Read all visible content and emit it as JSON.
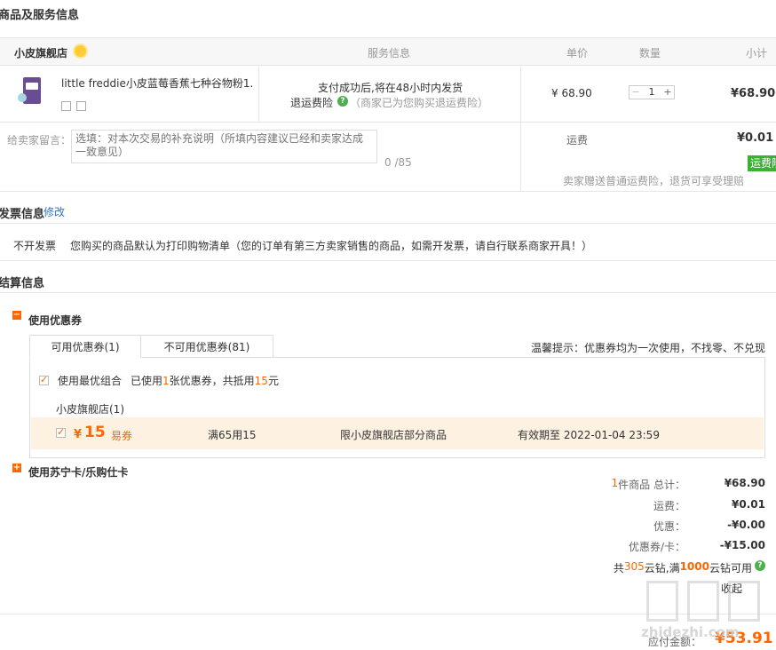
{
  "goods_section": {
    "title": "商品及服务信息"
  },
  "table_header": {
    "shop": "小皮旗舰店",
    "service": "服务信息",
    "unit_price": "单价",
    "quantity": "数量",
    "subtotal": "小计"
  },
  "item": {
    "name": "little freddie小皮蓝莓香蕉七种谷物粉1...",
    "service_line1": "支付成功后,将在48小时内发货",
    "service_line2_label": "退运费险",
    "service_line2_note": "（商家已为您购买退运费险）",
    "unit_price": "¥ 68.90",
    "qty_minus": "−",
    "qty_value": "1",
    "qty_plus": "+",
    "subtotal": "¥68.90"
  },
  "message": {
    "label": "给卖家留言：",
    "placeholder": "选填：对本次交易的补充说明（所填内容建议已经和卖家达成一致意见）",
    "counter": "0 /85",
    "shipping_label": "运费",
    "shipping_value": "¥0.01",
    "shipping_badge": "运费险",
    "shipping_note": "卖家赠送普通运费险，退货可享受理赔"
  },
  "invoice": {
    "title": "发票信息",
    "edit": "修改",
    "type": "不开发票",
    "desc": "您购买的商品默认为打印购物清单（您的订单有第三方卖家销售的商品，如需开发票，请自行联系商家开具！）"
  },
  "settle": {
    "title": "结算信息"
  },
  "coupon": {
    "title": "使用优惠券",
    "tab_available": "可用优惠券(1)",
    "tab_unavailable": "不可用优惠券(81)",
    "tip": "温馨提示：优惠券均为一次使用，不找零、不兑现",
    "best_combo": "使用最优组合",
    "used_prefix": "已使用",
    "used_count": "1",
    "used_mid": "张优惠券，共抵用",
    "used_amount": "15",
    "used_suffix": "元",
    "shop": "小皮旗舰店(1)",
    "currency": "¥",
    "amount": "15",
    "kind": "易券",
    "condition": "满65用15",
    "scope": "限小皮旗舰店部分商品",
    "expiry": "有效期至 2022-01-04 23:59"
  },
  "card": {
    "title": "使用苏宁卡/乐购仕卡"
  },
  "summary": {
    "count": "1",
    "goods_label": "件商品 总计：",
    "goods_total": "¥68.90",
    "shipping_label": "运费：",
    "shipping": "¥0.01",
    "discount_label": "优惠：",
    "discount": "-¥0.00",
    "coupon_label": "优惠券/卡：",
    "coupon": "-¥15.00",
    "yunzuan_prefix": "共",
    "yunzuan_count": "305",
    "yunzuan_mid": "云钻,满",
    "yunzuan_threshold": "1000",
    "yunzuan_suffix": "云钻可用",
    "fold_text": "收起",
    "pay_label": "应付金额：",
    "pay_amount": "¥53.91"
  },
  "watermark": {
    "text": "值 什么值得买",
    "url": "zhidezhi.com"
  },
  "colors": {
    "accent": "#ff6600",
    "green": "#3cb034",
    "coupon_bg": "#fdf2e2"
  }
}
